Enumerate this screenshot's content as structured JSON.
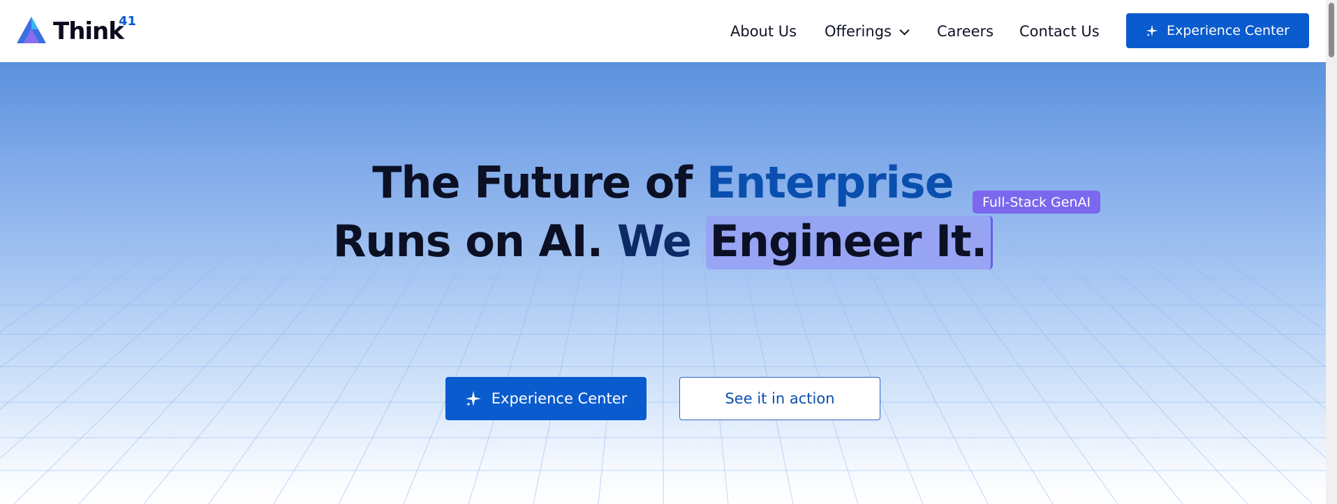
{
  "brand": {
    "name": "Think",
    "superscript": "41"
  },
  "nav": {
    "about": "About Us",
    "offerings": "Offerings",
    "careers": "Careers",
    "contact": "Contact Us",
    "cta": "Experience Center"
  },
  "hero": {
    "line1_part1": "The Future of ",
    "line1_accent": "Enterprise",
    "line2_part1": "Runs on AI. ",
    "line2_we": "We ",
    "line2_highlight": "Engineer It.",
    "tag": "Full-Stack GenAI",
    "primary_cta": "Experience Center",
    "secondary_cta": "See it in action"
  },
  "icons": {
    "logo": "think41-logo-icon",
    "sparkle": "sparkle-icon",
    "chevron": "chevron-down-icon"
  },
  "colors": {
    "brand_blue": "#0a5bcd",
    "tag_purple": "#7b68ee",
    "highlight": "#96a0f5"
  }
}
